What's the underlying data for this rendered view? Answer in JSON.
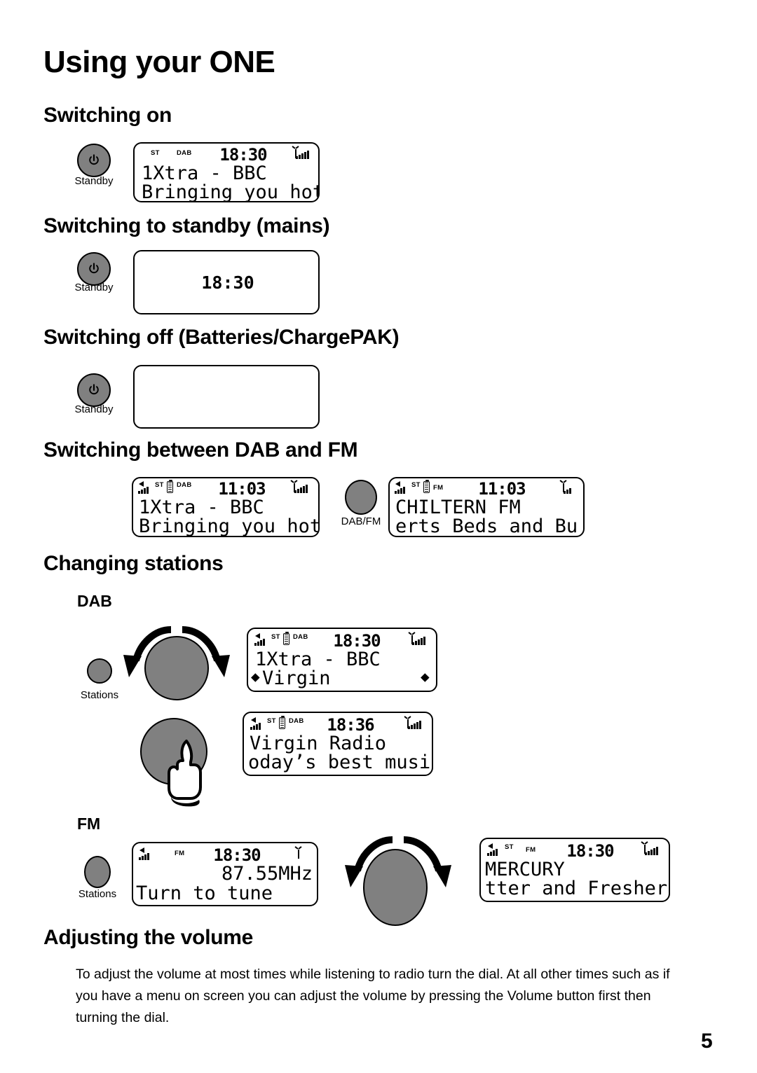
{
  "page": {
    "title": "Using your ONE",
    "number": "5"
  },
  "sections": {
    "switching_on": {
      "heading": "Switching on",
      "button_label": "Standby",
      "button_icon": "power-icon",
      "display": {
        "st": "ST",
        "band": "DAB",
        "time": "18:30",
        "line1": "1Xtra - BBC",
        "line2": "Bringing you hot",
        "signal_icon": "antenna-signal-icon"
      }
    },
    "switching_to_standby": {
      "heading": "Switching to standby (mains)",
      "button_label": "Standby",
      "button_icon": "power-icon",
      "display": {
        "time": "18:30"
      }
    },
    "switching_off": {
      "heading": "Switching off (Batteries/ChargePAK)",
      "button_label": "Standby",
      "button_icon": "power-icon",
      "display": {
        "blank": ""
      }
    },
    "switching_dab_fm": {
      "heading": "Switching between DAB and FM",
      "button_label": "DAB/FM",
      "display_left": {
        "speaker_icon": "speaker-icon",
        "st": "ST",
        "battery_icon": "battery-icon",
        "band": "DAB",
        "time": "11:03",
        "line1": "1Xtra - BBC",
        "line2": "Bringing you hot",
        "signal_icon": "antenna-signal-icon"
      },
      "display_right": {
        "speaker_icon": "speaker-icon",
        "st": "ST",
        "battery_icon": "battery-icon",
        "band": "FM",
        "time": "11:03",
        "line1": "CHILTERN FM",
        "line2": "erts Beds and Bu",
        "signal_icon": "antenna-signal-icon"
      }
    },
    "changing_stations": {
      "heading": "Changing stations",
      "dab": {
        "label": "DAB",
        "button_label": "Stations",
        "dial_icon": "rotary-dial-icon",
        "rotate_icon": "rotate-arrows-icon",
        "press_icon": "pressing-hand-icon",
        "display_turn": {
          "speaker_icon": "speaker-icon",
          "st": "ST",
          "battery_icon": "battery-icon",
          "band": "DAB",
          "time": "18:30",
          "line1": "1Xtra - BBC",
          "line2": "Virgin",
          "arrow_left": "◆",
          "arrow_right": "◆",
          "signal_icon": "antenna-signal-icon"
        },
        "display_press": {
          "speaker_icon": "speaker-icon",
          "st": "ST",
          "battery_icon": "battery-icon",
          "band": "DAB",
          "time": "18:36",
          "line1": "Virgin Radio",
          "line2": "oday’s best musi",
          "signal_icon": "antenna-signal-icon"
        }
      },
      "fm": {
        "label": "FM",
        "button_label": "Stations",
        "dial_icon": "rotary-dial-icon",
        "rotate_icon": "rotate-arrows-icon",
        "display_tune": {
          "speaker_icon": "speaker-icon",
          "band": "FM",
          "time": "18:30",
          "line1": "87.55MHz",
          "line2": "Turn to tune",
          "signal_icon": "antenna-icon"
        },
        "display_tuned": {
          "speaker_icon": "speaker-icon",
          "st": "ST",
          "band": "FM",
          "time": "18:30",
          "line1": "MERCURY",
          "line2": "tter and Fresher",
          "signal_icon": "antenna-signal-icon"
        }
      }
    },
    "adjusting_volume": {
      "heading": "Adjusting the volume",
      "paragraph": "To adjust the volume at most times while listening to radio turn the dial. At all other times such as if you have a menu on screen you can adjust the volume by pressing the Volume button first then turning the dial."
    }
  },
  "colors": {
    "knob_gray": "#808080",
    "ink": "#000000",
    "paper": "#ffffff"
  }
}
